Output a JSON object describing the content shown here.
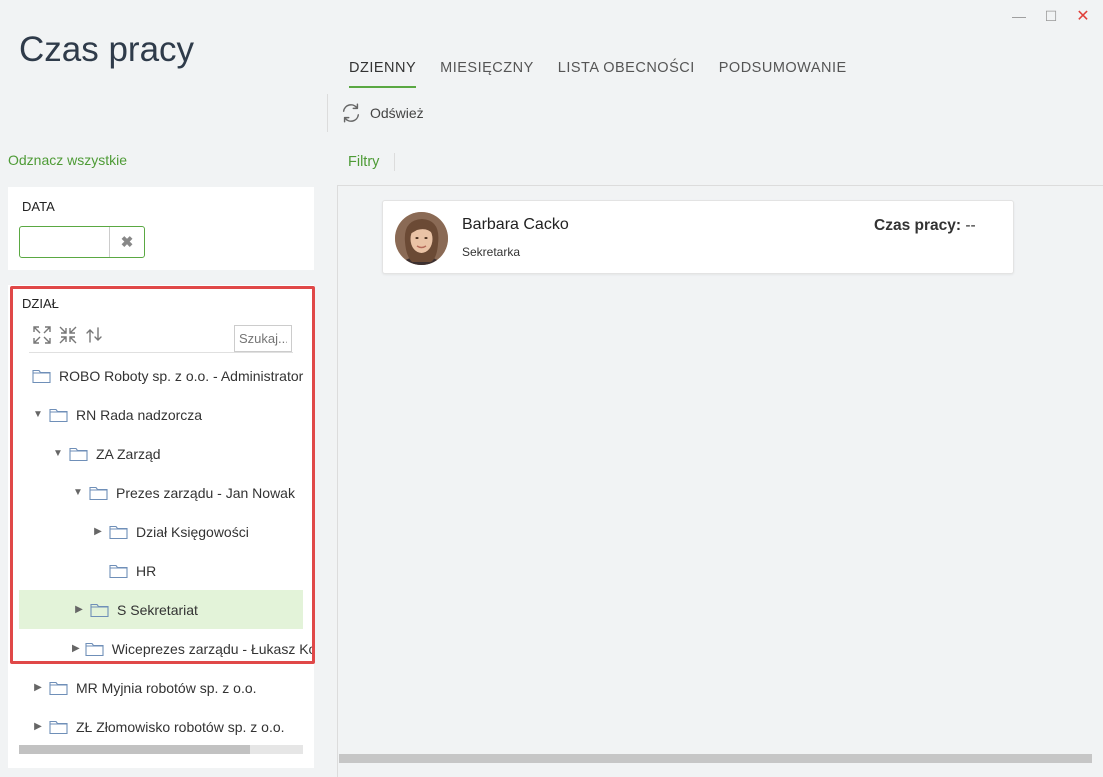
{
  "app": {
    "title": "Czas pracy"
  },
  "window": {
    "minimize": "—",
    "maximize": "☐",
    "close": "✕"
  },
  "tabs": [
    {
      "label": "DZIENNY",
      "active": true
    },
    {
      "label": "MIESIĘCZNY",
      "active": false
    },
    {
      "label": "LISTA OBECNOŚCI",
      "active": false
    },
    {
      "label": "PODSUMOWANIE",
      "active": false
    }
  ],
  "toolbar": {
    "refresh_label": "Odśwież"
  },
  "sidebar": {
    "select_all": "Odznacz wszystkie",
    "date": {
      "label": "DATA",
      "value": "",
      "clear_icon": "close-icon"
    },
    "department": {
      "label": "DZIAŁ",
      "search_placeholder": "Szukaj...",
      "tools": [
        "expand-all-icon",
        "collapse-all-icon",
        "reload-icon"
      ],
      "tree": [
        {
          "label": "ROBO Roboty sp. z o.o. - Administrator",
          "level": 0,
          "toggle": "none",
          "selected": false
        },
        {
          "label": "RN Rada nadzorcza",
          "level": 0,
          "toggle": "expanded",
          "selected": false
        },
        {
          "label": "ZA Zarząd",
          "level": 1,
          "toggle": "expanded",
          "selected": false
        },
        {
          "label": "Prezes zarządu - Jan Nowak",
          "level": 2,
          "toggle": "expanded",
          "selected": false
        },
        {
          "label": "Dział Księgowości",
          "level": 3,
          "toggle": "collapsed",
          "selected": false
        },
        {
          "label": "HR",
          "level": 3,
          "toggle": "none",
          "selected": false
        },
        {
          "label": "S Sekretariat",
          "level": 2,
          "toggle": "collapsed",
          "selected": true
        },
        {
          "label": "Wiceprezes zarządu - Łukasz Kowalski",
          "level": 2,
          "toggle": "collapsed",
          "selected": false
        },
        {
          "label": "MR Myjnia robotów sp. z o.o.",
          "level": 0,
          "toggle": "collapsed",
          "selected": false
        },
        {
          "label": "ZŁ Złomowisko robotów sp. z o.o.",
          "level": 0,
          "toggle": "collapsed",
          "selected": false
        }
      ]
    }
  },
  "filters": {
    "label": "Filtry"
  },
  "employees": [
    {
      "name": "Barbara Cacko",
      "role": "Sekretarka",
      "work_time_label": "Czas pracy:",
      "work_time_value": "--"
    }
  ],
  "colors": {
    "accent": "#5aa842",
    "selected_row": "#e3f3d9",
    "highlight": "#e04848",
    "close": "#e0403a"
  }
}
